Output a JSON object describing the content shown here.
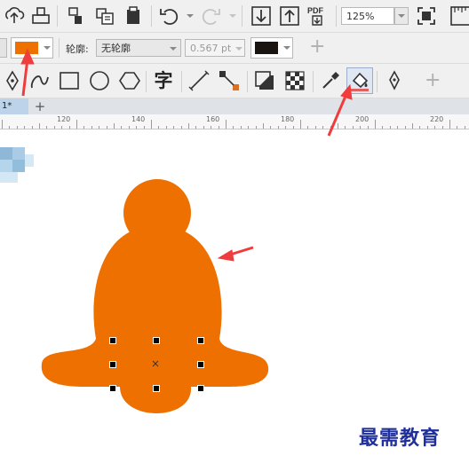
{
  "standard_toolbar": {
    "zoom_value": "125%",
    "pdf_label": "PDF"
  },
  "property_bar": {
    "fill_color": "#EE7000",
    "outline_label": "轮廓:",
    "outline_style": "无轮廓",
    "outline_width": "0.567 pt",
    "outline_color": "#1a1410",
    "add_label": "+"
  },
  "tools_bar": {
    "text_tool_label": "字",
    "add_label": "+"
  },
  "tabs": {
    "active_tab": "1*",
    "add_label": "+"
  },
  "ruler": {
    "labels": [
      "120",
      "140",
      "160",
      "180",
      "200",
      "220"
    ]
  },
  "canvas": {
    "shape": "bell",
    "shape_color": "#EE7000",
    "arrow_color": "#F03C3C"
  },
  "watermark": {
    "text": "最需教育"
  }
}
